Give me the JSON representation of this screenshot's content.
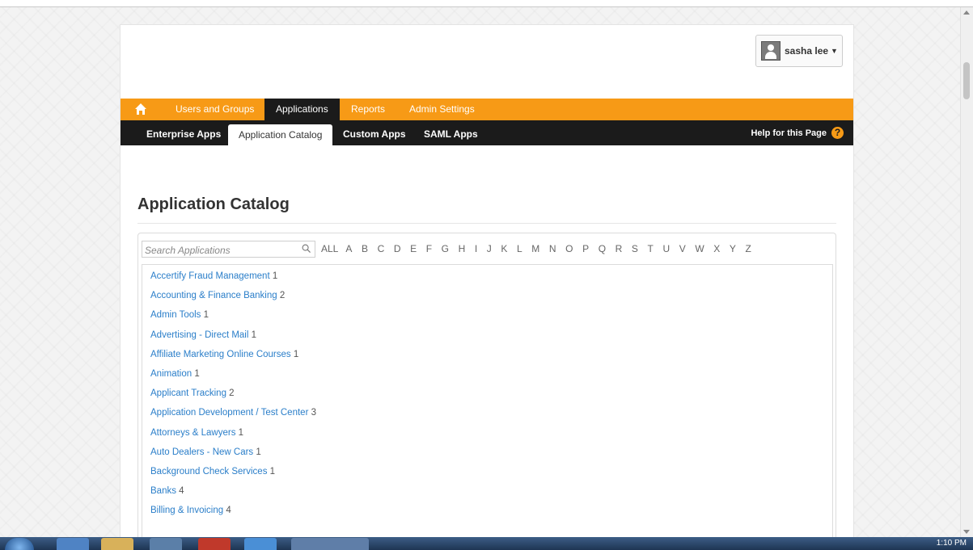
{
  "user": {
    "name": "sasha lee"
  },
  "main_nav": [
    {
      "label": "Users and Groups",
      "active": false
    },
    {
      "label": "Applications",
      "active": true
    },
    {
      "label": "Reports",
      "active": false
    },
    {
      "label": "Admin Settings",
      "active": false
    }
  ],
  "sub_nav": [
    {
      "label": "Enterprise Apps",
      "active": false
    },
    {
      "label": "Application Catalog",
      "active": true
    },
    {
      "label": "Custom Apps",
      "active": false
    },
    {
      "label": "SAML Apps",
      "active": false
    }
  ],
  "help_label": "Help for this Page",
  "page_title": "Application Catalog",
  "search": {
    "placeholder": "Search Applications"
  },
  "letters": [
    "ALL",
    "A",
    "B",
    "C",
    "D",
    "E",
    "F",
    "G",
    "H",
    "I",
    "J",
    "K",
    "L",
    "M",
    "N",
    "O",
    "P",
    "Q",
    "R",
    "S",
    "T",
    "U",
    "V",
    "W",
    "X",
    "Y",
    "Z"
  ],
  "categories": [
    {
      "name": "Accertify Fraud Management",
      "count": "1"
    },
    {
      "name": "Accounting & Finance Banking",
      "count": "2"
    },
    {
      "name": "Admin Tools",
      "count": "1"
    },
    {
      "name": "Advertising - Direct Mail",
      "count": "1"
    },
    {
      "name": "Affiliate Marketing Online Courses",
      "count": "1"
    },
    {
      "name": "Animation",
      "count": "1"
    },
    {
      "name": "Applicant Tracking",
      "count": "2"
    },
    {
      "name": "Application Development / Test Center",
      "count": "3"
    },
    {
      "name": "Attorneys & Lawyers",
      "count": "1"
    },
    {
      "name": "Auto Dealers - New Cars",
      "count": "1"
    },
    {
      "name": "Background Check Services",
      "count": "1"
    },
    {
      "name": "Banks",
      "count": "4"
    },
    {
      "name": "Billing & Invoicing",
      "count": "4"
    }
  ],
  "taskbar": {
    "clock": "1:10 PM"
  },
  "colors": {
    "accent": "#f79a16",
    "subnav": "#1b1b1b",
    "link": "#2a7ec9"
  }
}
